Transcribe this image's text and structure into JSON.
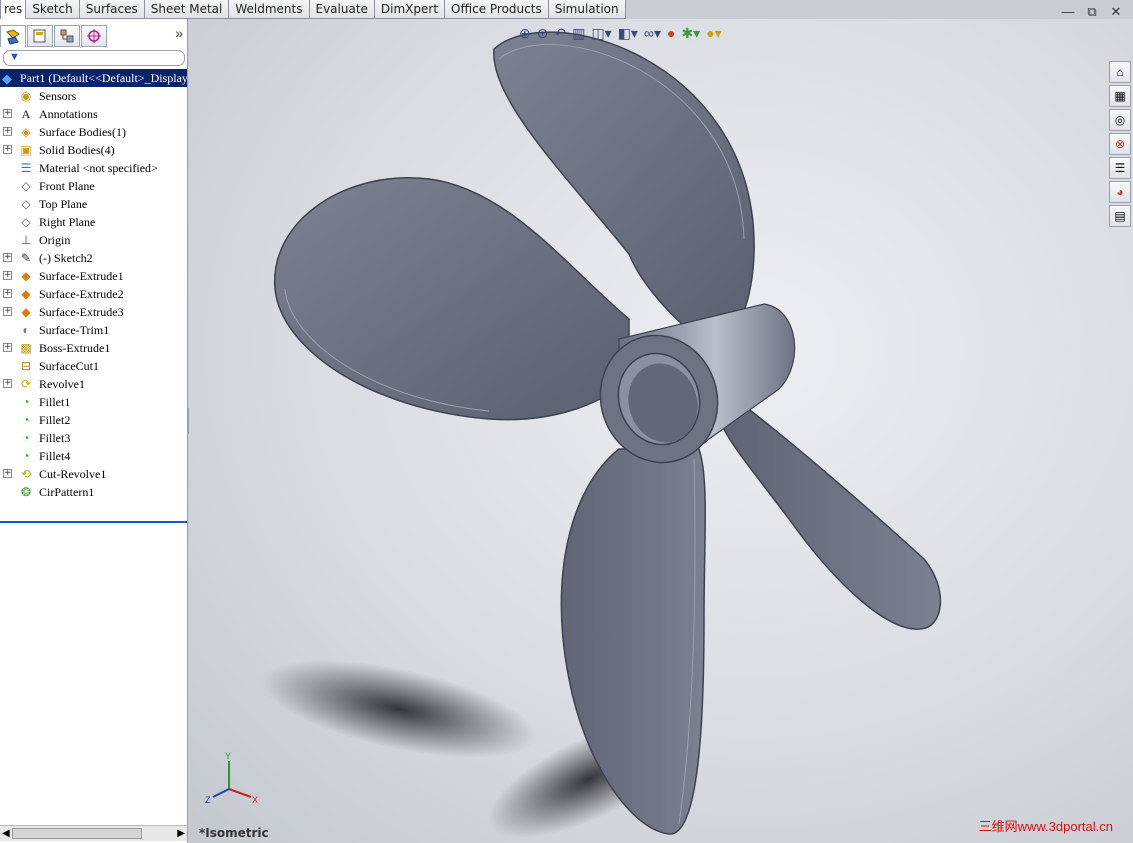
{
  "command_tabs": [
    "res",
    "Sketch",
    "Surfaces",
    "Sheet Metal",
    "Weldments",
    "Evaluate",
    "DimXpert",
    "Office Products",
    "Simulation"
  ],
  "window_controls": {
    "minimize": "—",
    "restore": "⧉",
    "close": "✕"
  },
  "panel": {
    "expand_glyph": "»",
    "root_label": "Part1  (Default<<Default>_Display",
    "items": [
      {
        "label": "Sensors",
        "expandable": false,
        "icon": "sensor-icon"
      },
      {
        "label": "Annotations",
        "expandable": true,
        "icon": "annotation-icon"
      },
      {
        "label": "Surface Bodies(1)",
        "expandable": true,
        "icon": "surface-bodies-icon"
      },
      {
        "label": "Solid Bodies(4)",
        "expandable": true,
        "icon": "solid-bodies-icon"
      },
      {
        "label": "Material <not specified>",
        "expandable": false,
        "icon": "material-icon"
      },
      {
        "label": "Front Plane",
        "expandable": false,
        "icon": "plane-icon"
      },
      {
        "label": "Top Plane",
        "expandable": false,
        "icon": "plane-icon"
      },
      {
        "label": "Right Plane",
        "expandable": false,
        "icon": "plane-icon"
      },
      {
        "label": "Origin",
        "expandable": false,
        "icon": "origin-icon"
      },
      {
        "label": "(-) Sketch2",
        "expandable": true,
        "icon": "sketch-icon"
      },
      {
        "label": "Surface-Extrude1",
        "expandable": true,
        "icon": "surface-extrude-icon"
      },
      {
        "label": "Surface-Extrude2",
        "expandable": true,
        "icon": "surface-extrude-icon"
      },
      {
        "label": "Surface-Extrude3",
        "expandable": true,
        "icon": "surface-extrude-icon"
      },
      {
        "label": "Surface-Trim1",
        "expandable": false,
        "icon": "surface-trim-icon"
      },
      {
        "label": "Boss-Extrude1",
        "expandable": true,
        "icon": "boss-extrude-icon"
      },
      {
        "label": "SurfaceCut1",
        "expandable": false,
        "icon": "surface-cut-icon"
      },
      {
        "label": "Revolve1",
        "expandable": true,
        "icon": "revolve-icon"
      },
      {
        "label": "Fillet1",
        "expandable": false,
        "icon": "fillet-icon"
      },
      {
        "label": "Fillet2",
        "expandable": false,
        "icon": "fillet-icon"
      },
      {
        "label": "Fillet3",
        "expandable": false,
        "icon": "fillet-icon"
      },
      {
        "label": "Fillet4",
        "expandable": false,
        "icon": "fillet-icon"
      },
      {
        "label": "Cut-Revolve1",
        "expandable": true,
        "icon": "cut-revolve-icon"
      },
      {
        "label": "CirPattern1",
        "expandable": false,
        "icon": "cir-pattern-icon"
      }
    ]
  },
  "viewport": {
    "view_name": "*Isometric",
    "watermark": "三维网www.3dportal.cn",
    "triad": {
      "x": "X",
      "y": "Y",
      "z": "Z"
    },
    "colors": {
      "model": "#6f7585",
      "model_edge": "#3d4250",
      "hub_highlight": "#b9bfca"
    }
  }
}
